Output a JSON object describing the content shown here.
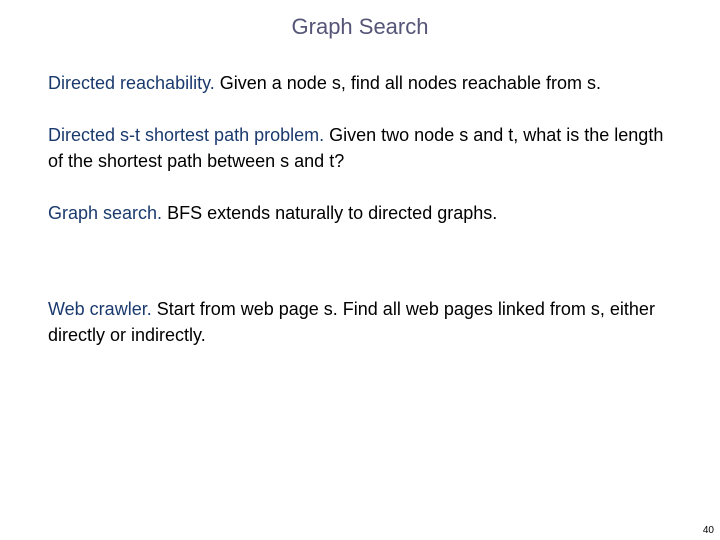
{
  "title": "Graph Search",
  "paragraphs": {
    "p1": {
      "term": "Directed reachability.",
      "text": "  Given a node s, find all nodes reachable from s."
    },
    "p2": {
      "term": "Directed s-t shortest path problem.",
      "text": "  Given two node s and t, what is the length of the shortest path between s and t?"
    },
    "p3": {
      "term": "Graph search.",
      "text": "  BFS extends naturally to directed graphs."
    },
    "p4": {
      "term": "Web crawler.",
      "text": "  Start from web page s.  Find all web pages linked from s, either directly or indirectly."
    }
  },
  "page_number": "40"
}
